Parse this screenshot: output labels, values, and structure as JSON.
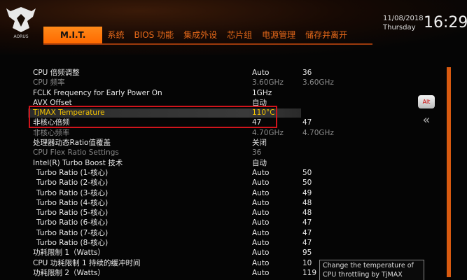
{
  "header": {
    "date": "11/08/2018",
    "day": "Thursday",
    "time": "16:29",
    "tabs": [
      "M.I.T.",
      "系统",
      "BIOS 功能",
      "集成外设",
      "芯片组",
      "电源管理",
      "储存并离开"
    ]
  },
  "settings": [
    {
      "name": "CPU 倍频调整",
      "value": "Auto",
      "current": "36",
      "state": "normal"
    },
    {
      "name": "CPU 频率",
      "value": "3.60GHz",
      "current": "3.60GHz",
      "state": "dim"
    },
    {
      "name": "FCLK Frequency for Early Power On",
      "value": "1GHz",
      "current": "",
      "state": "normal"
    },
    {
      "name": "AVX Offset",
      "value": "自动",
      "current": "",
      "state": "normal"
    },
    {
      "name": "TjMAX Temperature",
      "value": "110°C",
      "current": "",
      "state": "highlight"
    },
    {
      "name": "非核心倍频",
      "value": "47",
      "current": "47",
      "state": "normal"
    },
    {
      "name": "非核心频率",
      "value": "4.70GHz",
      "current": "4.70GHz",
      "state": "dim"
    },
    {
      "name": "处理器动态Ratio值覆盖",
      "value": "关闭",
      "current": "",
      "state": "normal"
    },
    {
      "name": "CPU Flex Ratio Settings",
      "value": "36",
      "current": "",
      "state": "dim"
    },
    {
      "name": "Intel(R) Turbo Boost 技术",
      "value": "自动",
      "current": "",
      "state": "normal"
    },
    {
      "name": "Turbo Ratio (1-核心)",
      "value": "Auto",
      "current": "50",
      "state": "indent"
    },
    {
      "name": "Turbo Ratio (2-核心)",
      "value": "Auto",
      "current": "50",
      "state": "indent"
    },
    {
      "name": "Turbo Ratio (3-核心)",
      "value": "Auto",
      "current": "49",
      "state": "indent"
    },
    {
      "name": "Turbo Ratio (4-核心)",
      "value": "Auto",
      "current": "48",
      "state": "indent"
    },
    {
      "name": "Turbo Ratio (5-核心)",
      "value": "Auto",
      "current": "48",
      "state": "indent"
    },
    {
      "name": "Turbo Ratio (6-核心)",
      "value": "Auto",
      "current": "47",
      "state": "indent"
    },
    {
      "name": "Turbo Ratio (7-核心)",
      "value": "Auto",
      "current": "47",
      "state": "indent"
    },
    {
      "name": "Turbo Ratio (8-核心)",
      "value": "Auto",
      "current": "47",
      "state": "indent"
    },
    {
      "name": "功耗限制 1（Watts）",
      "value": "Auto",
      "current": "95",
      "state": "normal"
    },
    {
      "name": "CPU 功耗限制 1 持续的缓冲时间",
      "value": "Auto",
      "current": "10",
      "state": "normal"
    },
    {
      "name": "功耗限制 2（Watts）",
      "value": "Auto",
      "current": "119",
      "state": "normal"
    }
  ],
  "side": {
    "alt_label": "Alt",
    "collapse_icon": "double-chevron-left-icon",
    "logo": "aorus-eagle-logo"
  },
  "help": {
    "text": "Change the temperature of CPU throttling by TjMAX"
  },
  "colors": {
    "accent": "#ff6a00",
    "highlight": "#f5c400",
    "selection_border": "#d0141b"
  }
}
